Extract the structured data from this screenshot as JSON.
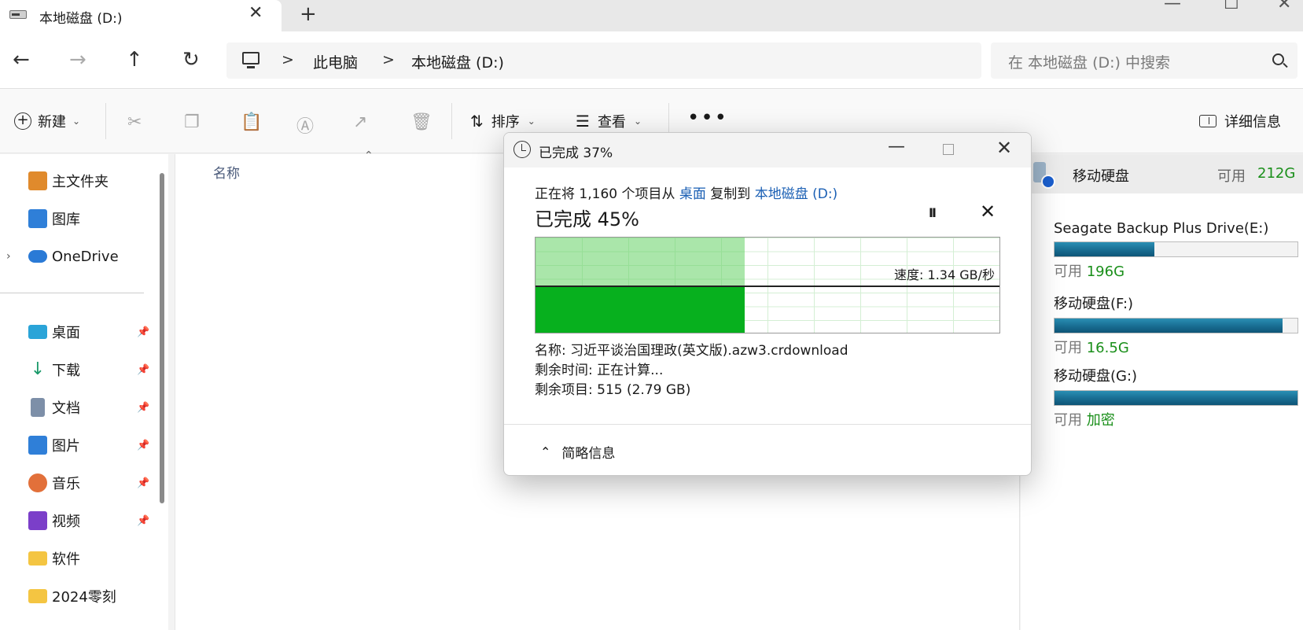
{
  "tab": {
    "title": "本地磁盘 (D:)",
    "close": "✕",
    "new_tab": "+"
  },
  "window_controls": {
    "minimize": "—",
    "maximize": "☐",
    "close": "✕"
  },
  "nav": {
    "back": "←",
    "forward": "→",
    "up": "↑",
    "refresh": "↻",
    "breadcrumb": [
      "此电脑",
      "本地磁盘 (D:)"
    ],
    "separator": ">",
    "search_placeholder": "在 本地磁盘 (D:) 中搜索"
  },
  "toolbar": {
    "new_label": "新建",
    "sort_label": "排序",
    "view_label": "查看",
    "more": "•••",
    "details_label": "详细信息",
    "icons": [
      "cut-icon",
      "copy-icon",
      "paste-icon",
      "rename-icon",
      "share-icon",
      "delete-icon"
    ]
  },
  "sidebar": {
    "items": [
      {
        "label": "主文件夹",
        "icon": "home-icon",
        "color": "#e08a2c"
      },
      {
        "label": "图库",
        "icon": "gallery-icon",
        "color": "#2f7fd8"
      },
      {
        "label": "OneDrive",
        "icon": "cloud-icon",
        "color": "#2a7ad6"
      },
      {
        "label": "桌面",
        "icon": "desktop-icon",
        "color": "#2aa4d8"
      },
      {
        "label": "下载",
        "icon": "download-icon",
        "color": "#1b9a6a"
      },
      {
        "label": "文档",
        "icon": "document-icon",
        "color": "#7d8fa8"
      },
      {
        "label": "图片",
        "icon": "pictures-icon",
        "color": "#2f7fd8"
      },
      {
        "label": "音乐",
        "icon": "music-icon",
        "color": "#e2703a"
      },
      {
        "label": "视频",
        "icon": "video-icon",
        "color": "#7b3fc9"
      },
      {
        "label": "软件",
        "icon": "folder-icon",
        "color": "#f4c542"
      },
      {
        "label": "2024零刻",
        "icon": "folder-icon",
        "color": "#f4c542"
      }
    ]
  },
  "content": {
    "column_name": "名称"
  },
  "details_pane": {
    "header": {
      "name": "移动硬盘",
      "avail_label": "可用",
      "avail_value": "212G"
    },
    "drives": [
      {
        "name": "Seagate Backup Plus Drive(E:)",
        "used_fraction": 0.41,
        "free_label": "可用",
        "free_value": "196G"
      },
      {
        "name": "移动硬盘(F:)",
        "used_fraction": 0.94,
        "free_label": "可用",
        "free_value": "16.5G"
      },
      {
        "name": "移动硬盘(G:)",
        "used_fraction": 1.0,
        "free_label": "可用",
        "free_value": "加密"
      }
    ]
  },
  "dialog": {
    "title": "已完成 37%",
    "line1_prefix": "正在将 1,160 个项目从 ",
    "source": "桌面",
    "line1_mid": " 复制到 ",
    "dest": "本地磁盘 (D:)",
    "percent_text": "已完成 45%",
    "progress_fraction": 0.45,
    "speed_label": "速度: 1.34 GB/秒",
    "name_line": "名称: 习近平谈治国理政(英文版).azw3.crdownload",
    "time_line": "剩余时间: 正在计算...",
    "items_line": "剩余项目: 515 (2.79 GB)",
    "less_details": "简略信息",
    "pause": "II",
    "stop": "✕"
  }
}
